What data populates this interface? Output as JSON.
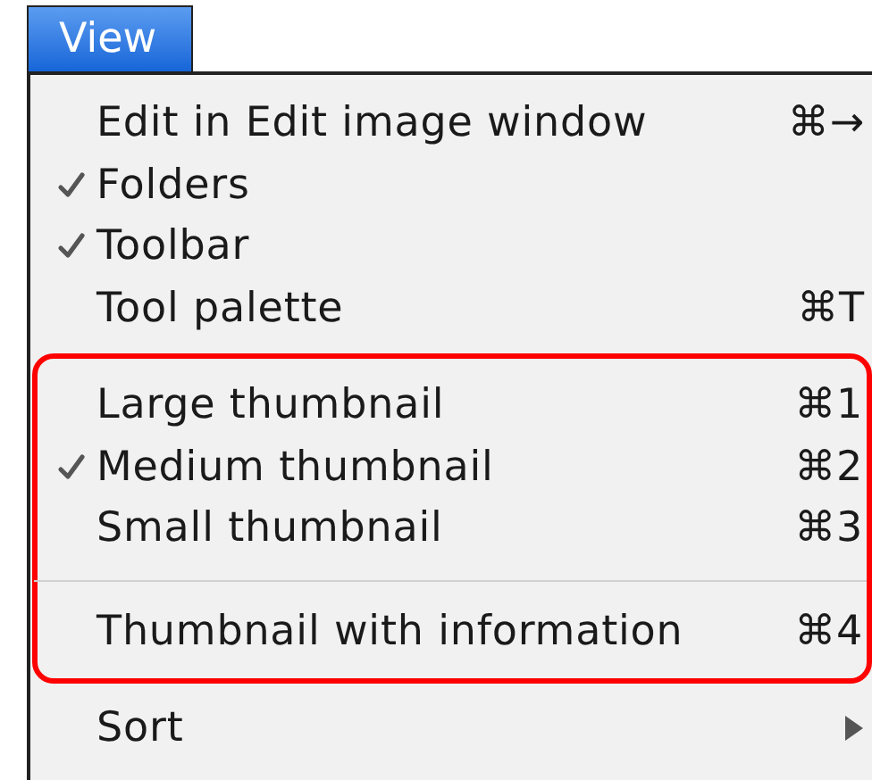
{
  "menu": {
    "title": "View",
    "blocks": [
      {
        "annotated": false,
        "items": [
          {
            "kind": "item",
            "label": "Edit in Edit image window",
            "checked": false,
            "shortcut": "⌘→",
            "submenu": false
          },
          {
            "kind": "item",
            "label": "Folders",
            "checked": true,
            "submenu": false
          },
          {
            "kind": "item",
            "label": "Toolbar",
            "checked": true,
            "submenu": false
          },
          {
            "kind": "item",
            "label": "Tool palette",
            "checked": false,
            "shortcut": "⌘T",
            "submenu": false
          }
        ]
      },
      {
        "annotated": true,
        "items": [
          {
            "kind": "item",
            "label": "Large thumbnail",
            "checked": false,
            "shortcut": "⌘1",
            "submenu": false
          },
          {
            "kind": "item",
            "label": "Medium thumbnail",
            "checked": true,
            "shortcut": "⌘2",
            "submenu": false
          },
          {
            "kind": "item",
            "label": "Small thumbnail",
            "checked": false,
            "shortcut": "⌘3",
            "submenu": false
          },
          {
            "kind": "separator"
          },
          {
            "kind": "item",
            "label": "Thumbnail with information",
            "checked": false,
            "shortcut": "⌘4",
            "submenu": false
          }
        ]
      },
      {
        "annotated": false,
        "items": [
          {
            "kind": "item",
            "label": "Sort",
            "checked": false,
            "submenu": true
          }
        ]
      }
    ]
  }
}
